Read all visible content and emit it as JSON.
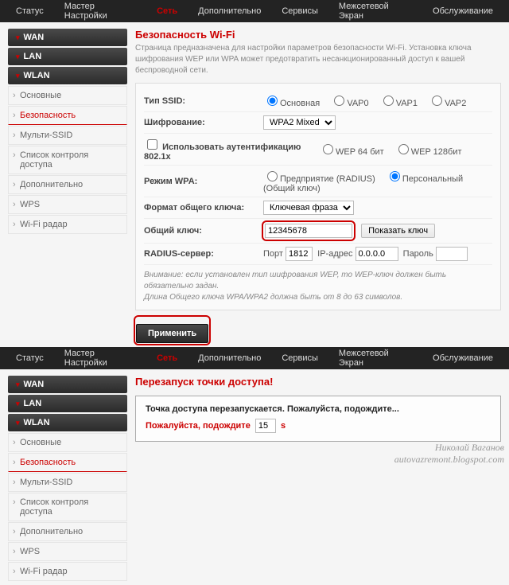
{
  "nav": {
    "items": [
      "Статус",
      "Мастер Настройки",
      "Сеть",
      "Дополнительно",
      "Сервисы",
      "Межсетевой Экран",
      "Обслуживание"
    ],
    "activeIndex": 2
  },
  "sidebar": {
    "cats": [
      "WAN",
      "LAN",
      "WLAN"
    ],
    "subs": [
      "Основные",
      "Безопасность",
      "Мульти-SSID",
      "Список контроля доступа",
      "Дополнительно",
      "WPS",
      "Wi-Fi радар"
    ],
    "activeSubIndex": 1
  },
  "page1": {
    "title": "Безопасность Wi-Fi",
    "desc": "Страница предназначена для настройки параметров безопасности Wi-Fi. Установка ключа шифрования WEP или WPA может предотвратить несанкционированный доступ к вашей беспроводной сети.",
    "rows": {
      "ssidType": {
        "label": "Тип SSID:",
        "options": [
          "Основная",
          "VAP0",
          "VAP1",
          "VAP2"
        ]
      },
      "encryption": {
        "label": "Шифрование:",
        "value": "WPA2 Mixed"
      },
      "auth8021x": {
        "label": "Использовать аутентификацию 802.1x",
        "options": [
          "WEP 64 бит",
          "WEP 128бит"
        ]
      },
      "wpaMode": {
        "label": "Режим WPA:",
        "options": [
          "Предприятие (RADIUS)",
          "Персональный (Общий ключ)"
        ]
      },
      "keyFormat": {
        "label": "Формат общего ключа:",
        "value": "Ключевая фраза"
      },
      "sharedKey": {
        "label": "Общий ключ:",
        "value": "12345678",
        "button": "Показать ключ"
      },
      "radius": {
        "label": "RADIUS-сервер:",
        "portLabel": "Порт",
        "portValue": "1812",
        "ipLabel": "IP-адрес",
        "ipValue": "0.0.0.0",
        "passLabel": "Пароль"
      }
    },
    "note1": "Внимание: если установлен тип шифрования WEP, то WEP-ключ должен быть обязательно задан.",
    "note2": "Длина Общего ключа WPA/WPA2 должна быть от 8 до 63 символов.",
    "applyBtn": "Применить"
  },
  "page2": {
    "title": "Перезапуск точки доступа!",
    "line1": "Точка доступа перезапускается. Пожалуйста, подождите...",
    "line2a": "Пожалуйста, подождите",
    "seconds": "15",
    "line2b": "s"
  },
  "watermark": {
    "l1": "Николай Ваганов",
    "l2": "autovazremont.blogspot.com"
  }
}
